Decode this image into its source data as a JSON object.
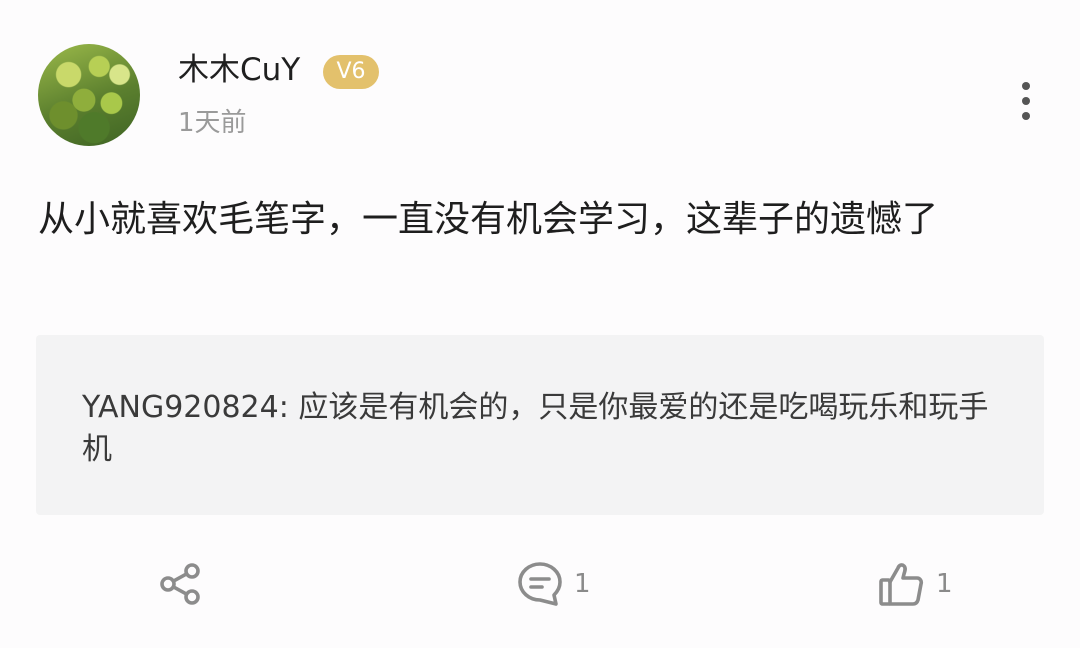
{
  "author": {
    "name": "木木CuY",
    "level_badge": "V6",
    "time": "1天前"
  },
  "post": {
    "text": "从小就喜欢毛笔字，一直没有机会学习，这辈子的遗憾了"
  },
  "quoted_reply": {
    "text": "YANG920824: 应该是有机会的，只是你最爱的还是吃喝玩乐和玩手机"
  },
  "actions": {
    "share_icon": "share-icon",
    "comment_icon": "comment-icon",
    "comment_count": "1",
    "like_icon": "thumbs-up-icon",
    "like_count": "1"
  },
  "colors": {
    "badge": "#e3c16c",
    "quote_bg": "#f3f3f4",
    "icon": "#8c8c8c"
  }
}
